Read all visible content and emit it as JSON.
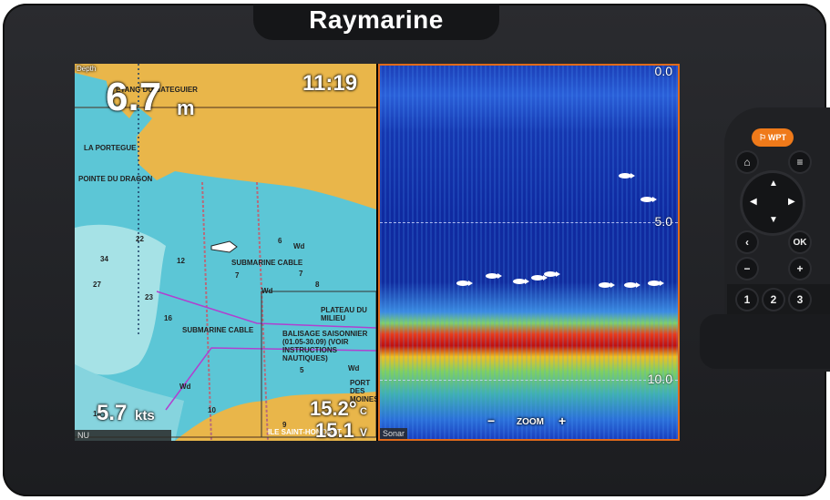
{
  "brand": "Raymarine",
  "chart": {
    "depth_label": "Depth",
    "depth_value": "6.7",
    "depth_unit": "m",
    "time": "11:19",
    "speed_value": "5.7",
    "speed_unit": "kts",
    "temp_value": "15.2°",
    "temp_unit": "C",
    "voltage_value": "15.1",
    "voltage_unit": "V",
    "pane_tag": "NU",
    "place_names": [
      "ETANG DU BATEGUIER",
      "LA PORTEGUE",
      "POINTE DU DRAGON",
      "SUBMARINE CABLE",
      "SUBMARINE CABLE",
      "PLATEAU DU MILIEU",
      "BALISAGE SAISONNIER (01.05-30.09) (VOIR INSTRUCTIONS NAUTIQUES)",
      "PORT DES MOINES",
      "ILE SAINT-HONORAT",
      "Wd",
      "Wd",
      "Wd",
      "Wd"
    ],
    "soundings": [
      "22",
      "34",
      "27",
      "23",
      "16",
      "12",
      "7",
      "6",
      "7",
      "5",
      "8",
      "10",
      "9",
      "18"
    ]
  },
  "sonar": {
    "pane_tag": "Sonar",
    "depth_scale": [
      "0.0",
      "5.0",
      "10.0"
    ],
    "zoom_label": "ZOOM",
    "zoom_minus": "−",
    "zoom_plus": "+",
    "colors": {
      "frame": "#e06a1a"
    }
  },
  "keypad": {
    "wpt_label": "WPT",
    "ok_label": "OK",
    "minus": "−",
    "plus": "+",
    "numbers": [
      "1",
      "2",
      "3"
    ],
    "colors": {
      "wpt": "#ef7a1a"
    }
  }
}
